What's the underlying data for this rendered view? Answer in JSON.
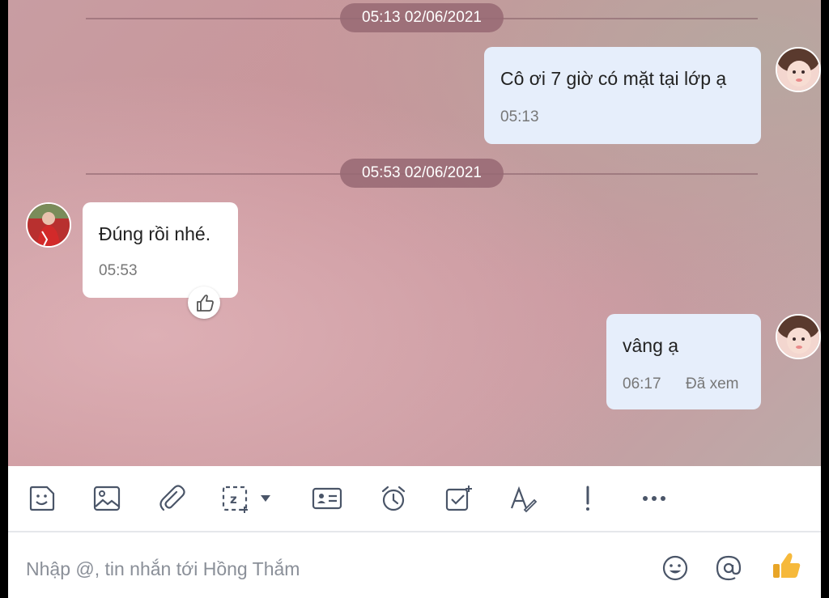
{
  "chat": {
    "separators": [
      {
        "label": "05:13 02/06/2021"
      },
      {
        "label": "05:53 02/06/2021"
      }
    ],
    "messages": [
      {
        "direction": "out",
        "text": "Cô ơi 7 giờ có mặt tại lớp ạ",
        "time": "05:13"
      },
      {
        "direction": "in",
        "text": "Đúng rồi nhé.",
        "time": "05:53",
        "reaction": "thumbs-up-icon"
      },
      {
        "direction": "out",
        "text": "vâng ạ",
        "time": "06:17",
        "status": "Đã xem"
      }
    ]
  },
  "toolbar": {
    "tools": [
      "sticker-icon",
      "image-icon",
      "attachment-icon",
      "screenshot-icon",
      "contact-card-icon",
      "reminder-clock-icon",
      "task-check-icon",
      "text-format-icon",
      "important-icon",
      "more-icon"
    ]
  },
  "composer": {
    "placeholder": "Nhập @, tin nhắn tới Hồng Thắm",
    "buttons": [
      "emoji-icon",
      "mention-icon",
      "quick-like-icon"
    ]
  },
  "colors": {
    "out_bubble": "#e6eefb",
    "in_bubble": "#ffffff",
    "separator_pill": "#96697380",
    "like_yellow": "#f6b93b",
    "icon_gray": "#4a5568"
  }
}
